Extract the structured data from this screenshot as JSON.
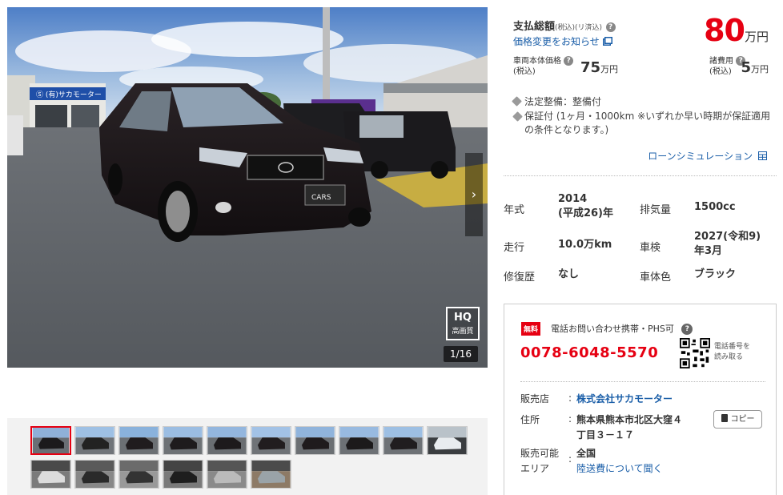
{
  "gallery": {
    "counter": "1/16",
    "hq_top": "HQ",
    "hq_bottom": "高画質",
    "next_arrow": "›",
    "dealer_sign": "Ⓢ (有)サカモーター",
    "plate_text": "CARS"
  },
  "price": {
    "total_label": "支払総額",
    "total_tax_note": "(税込)(リ済込)",
    "help_glyph": "?",
    "total_value": "80",
    "unit": "万円",
    "change_notice": "価格変更をお知らせ",
    "body_label_1": "車両本体価格",
    "body_label_2": "(税込)",
    "body_value": "75",
    "fee_label_1": "諸費用",
    "fee_label_2": "(税込)",
    "fee_value": "5"
  },
  "tags": {
    "inspection": "法定整備：整備付",
    "warranty_1": "保証付 (1ヶ月・1000km ※いずれか早い時期が保証適用",
    "warranty_2": "の条件となります。)"
  },
  "loan_link": "ローンシミュレーション",
  "specs": {
    "year_label": "年式",
    "year_value_1": "2014",
    "year_value_2": "(平成26)年",
    "displacement_label": "排気量",
    "displacement_value": "1500cc",
    "mileage_label": "走行",
    "mileage_value": "10.0万km",
    "inspection_label": "車検",
    "inspection_value_1": "2027(令和9)",
    "inspection_value_2": "年3月",
    "repair_label": "修復歴",
    "repair_value": "なし",
    "color_label": "車体色",
    "color_value": "ブラック"
  },
  "contact": {
    "free_badge": "無料",
    "title": "電話お問い合わせ携帯・PHS可",
    "phone": "0078-6048-5570",
    "qr_text_1": "電話番号を",
    "qr_text_2": "読み取る",
    "shop_label": "販売店",
    "shop_value": "株式会社サカモーター",
    "address_label": "住所",
    "address_1": "熊本県熊本市北区大窪４",
    "address_2": "丁目３－１７",
    "copy_button": "コピー",
    "area_label_1": "販売可能",
    "area_label_2": "エリア",
    "area_value": "全国",
    "shipping_link": "陸送費について聞く",
    "colon": ":"
  },
  "colors": {
    "accent_red": "#e60012",
    "link_blue": "#1a5ea8"
  },
  "thumbnails": [
    "front-left",
    "front",
    "rear-left",
    "left-side",
    "left-front",
    "front-right",
    "right-side",
    "rear",
    "rear-right",
    "dashboard",
    "trunk",
    "interior-driver",
    "rear-seat",
    "door-open",
    "dash-close",
    "engine"
  ]
}
